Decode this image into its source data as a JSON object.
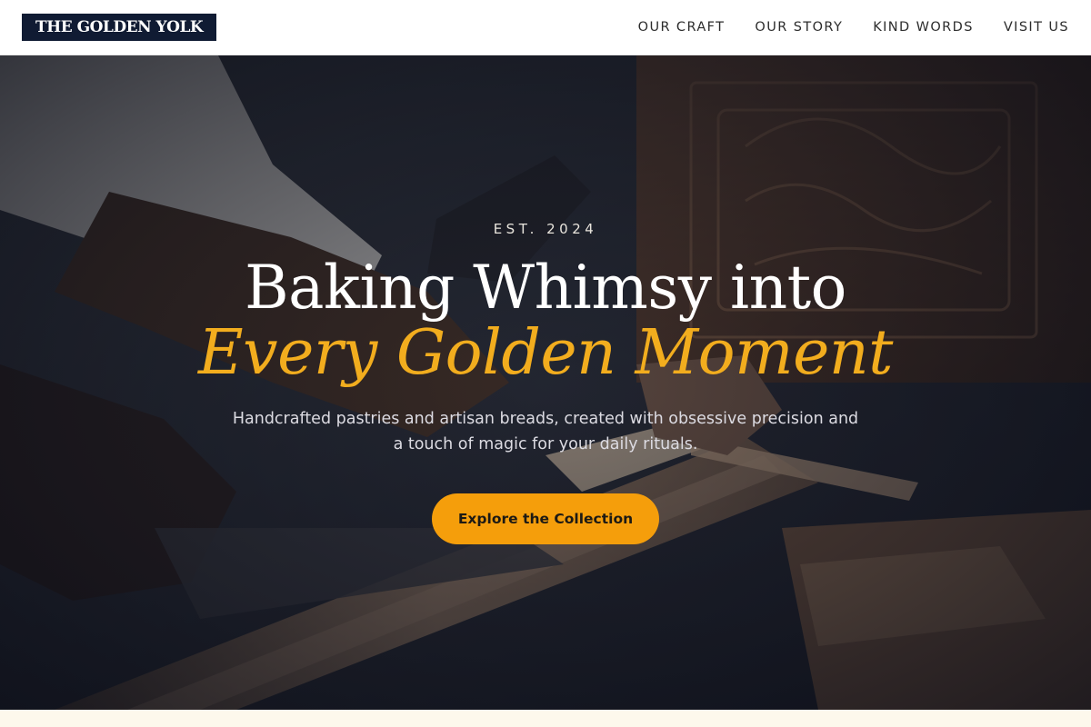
{
  "header": {
    "brand": "THE GOLDEN YOLK",
    "nav": [
      {
        "label": "OUR CRAFT"
      },
      {
        "label": "OUR STORY"
      },
      {
        "label": "KIND WORDS"
      },
      {
        "label": "VISIT US"
      }
    ]
  },
  "hero": {
    "eyebrow": "EST. 2024",
    "headline": "Baking Whimsy into",
    "headline_accent": "Every Golden Moment",
    "subtext": "Handcrafted pastries and artisan breads, created with obsessive precision and a touch of magic for your daily rituals.",
    "cta_label": "Explore the Collection",
    "background_image": "woodworker-carving-photo"
  },
  "colors": {
    "brand_bg": "#101b33",
    "accent": "#f2ad1e",
    "cta": "#f59e0b",
    "page_bg": "#fdf8ec"
  }
}
